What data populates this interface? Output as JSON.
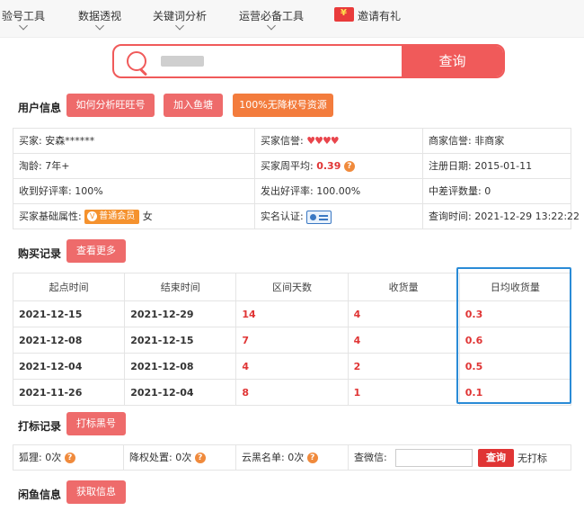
{
  "nav": {
    "items": [
      "验号工具",
      "数据透视",
      "关键词分析",
      "运营必备工具"
    ],
    "invite": "邀请有礼"
  },
  "search": {
    "button": "查询"
  },
  "user_info": {
    "title": "用户信息",
    "buttons": [
      "如何分析旺旺号",
      "加入鱼塘",
      "100%无降权号资源"
    ],
    "rows": [
      [
        {
          "label": "买家:",
          "value": "安森******"
        },
        {
          "label": "买家信誉:",
          "value": "♥♥♥♥"
        },
        {
          "label": "商家信誉:",
          "value": "非商家"
        }
      ],
      [
        {
          "label": "淘龄:",
          "value": "7年+"
        },
        {
          "label": "买家周平均:",
          "value": "0.39"
        },
        {
          "label": "注册日期:",
          "value": "2015-01-11"
        }
      ],
      [
        {
          "label": "收到好评率:",
          "value": "100%"
        },
        {
          "label": "发出好评率:",
          "value": "100.00%"
        },
        {
          "label": "中差评数量:",
          "value": "0"
        }
      ],
      [
        {
          "label": "买家基础属性:",
          "value": "普通会员",
          "extra": "女"
        },
        {
          "label": "实名认证:",
          "value": ""
        },
        {
          "label": "查询时间:",
          "value": "2021-12-29 13:22:22"
        }
      ]
    ]
  },
  "purchase": {
    "title": "购买记录",
    "more_button": "查看更多",
    "headers": [
      "起点时间",
      "结束时间",
      "区间天数",
      "收货量",
      "日均收货量"
    ],
    "rows": [
      [
        "2021-12-15",
        "2021-12-29",
        "14",
        "4",
        "0.3"
      ],
      [
        "2021-12-08",
        "2021-12-15",
        "7",
        "4",
        "0.6"
      ],
      [
        "2021-12-04",
        "2021-12-08",
        "4",
        "2",
        "0.5"
      ],
      [
        "2021-11-26",
        "2021-12-04",
        "8",
        "1",
        "0.1"
      ]
    ]
  },
  "mark": {
    "title": "打标记录",
    "button": "打标黑号",
    "items": [
      {
        "label": "狐狸:",
        "value": "0次"
      },
      {
        "label": "降权处置:",
        "value": "0次"
      },
      {
        "label": "云黑名单:",
        "value": "0次"
      }
    ],
    "wechat_label": "查微信:",
    "wechat_button": "查询",
    "wechat_result": "无打标"
  },
  "idle_fish": {
    "title": "闲鱼信息",
    "button": "获取信息"
  },
  "colors": {
    "accent": "#f05a5a",
    "orange": "#f37c3d",
    "highlight": "#2a8bd6"
  }
}
